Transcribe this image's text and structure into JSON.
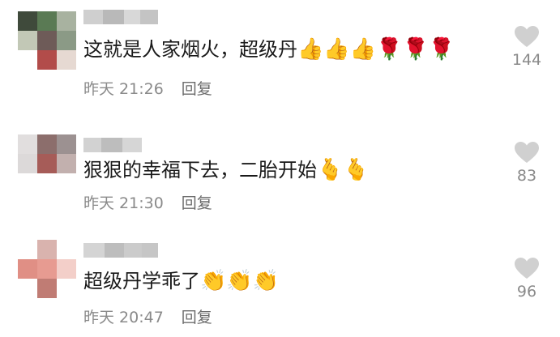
{
  "comments": [
    {
      "text": "这就是人家烟火，超级丹",
      "emojis": "👍👍👍🌹🌹🌹",
      "time": "昨天 21:26",
      "reply_label": "回复",
      "likes": "144"
    },
    {
      "text": "狠狠的幸福下去，二胎开始",
      "emojis": "🫰🫰",
      "time": "昨天 21:30",
      "reply_label": "回复",
      "likes": "83"
    },
    {
      "text": "超级丹学乖了",
      "emojis": "👏👏👏",
      "time": "昨天 20:47",
      "reply_label": "回复",
      "likes": "96"
    }
  ],
  "colors": {
    "text": "#1a1a1a",
    "meta": "#8a8a8a",
    "heart": "#d0d0d0"
  },
  "icons": {
    "like": "heart-icon"
  }
}
